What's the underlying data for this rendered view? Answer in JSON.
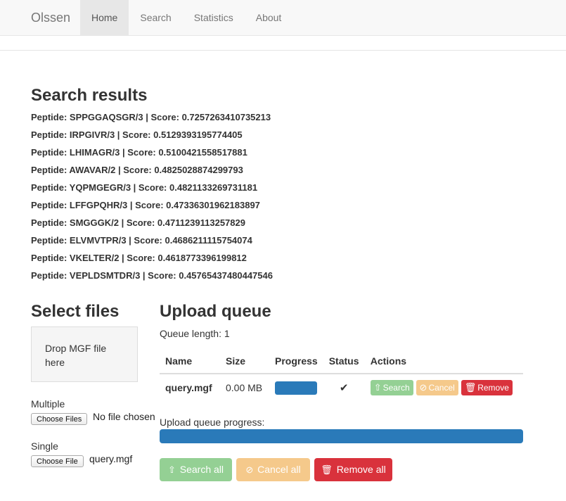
{
  "navbar": {
    "brand": "Olssen",
    "items": [
      {
        "label": "Home",
        "active": true
      },
      {
        "label": "Search"
      },
      {
        "label": "Statistics"
      },
      {
        "label": "About"
      }
    ]
  },
  "results": {
    "title": "Search results",
    "items": [
      "Peptide: SPPGGAQSGR/3 | Score: 0.7257263410735213",
      "Peptide: IRPGIVR/3 | Score: 0.5129393195774405",
      "Peptide: LHIMAGR/3 | Score: 0.5100421558517881",
      "Peptide: AWAVAR/2 | Score: 0.4825028874299793",
      "Peptide: YQPMGEGR/3 | Score: 0.4821133269731181",
      "Peptide: LFFGPQHR/3 | Score: 0.47336301962183897",
      "Peptide: SMGGGK/2 | Score: 0.4711239113257829",
      "Peptide: ELVMVTPR/3 | Score: 0.4686211115754074",
      "Peptide: VKELTER/2 | Score: 0.4618773396199812",
      "Peptide: VEPLDSMTDR/3 | Score: 0.45765437480447546"
    ]
  },
  "select": {
    "title": "Select files",
    "dropzone": "Drop MGF file here",
    "multiple_label": "Multiple",
    "multiple_button": "Choose Files",
    "multiple_status": "No file chosen",
    "single_label": "Single",
    "single_button": "Choose File",
    "single_status": "query.mgf"
  },
  "queue": {
    "title": "Upload queue",
    "length_text": "Queue length: 1",
    "columns": [
      "Name",
      "Size",
      "Progress",
      "Status",
      "Actions"
    ],
    "rows": [
      {
        "name": "query.mgf",
        "size": "0.00 MB",
        "progress": 100,
        "status": "✔",
        "search": "Search",
        "cancel": "Cancel",
        "remove": "Remove"
      }
    ],
    "progress_label": "Upload queue progress:",
    "progress_percent": 100,
    "search_all": "Search all",
    "cancel_all": "Cancel all",
    "remove_all": "Remove all"
  },
  "colors": {
    "progress": "#2a7ab9",
    "success": "#5cb85c",
    "warning": "#f0ad4e",
    "danger": "#d9323c"
  },
  "icons": {
    "search": "circle-arrow-up-icon",
    "cancel": "ban-icon",
    "remove": "trash-icon",
    "status": "check-icon"
  }
}
